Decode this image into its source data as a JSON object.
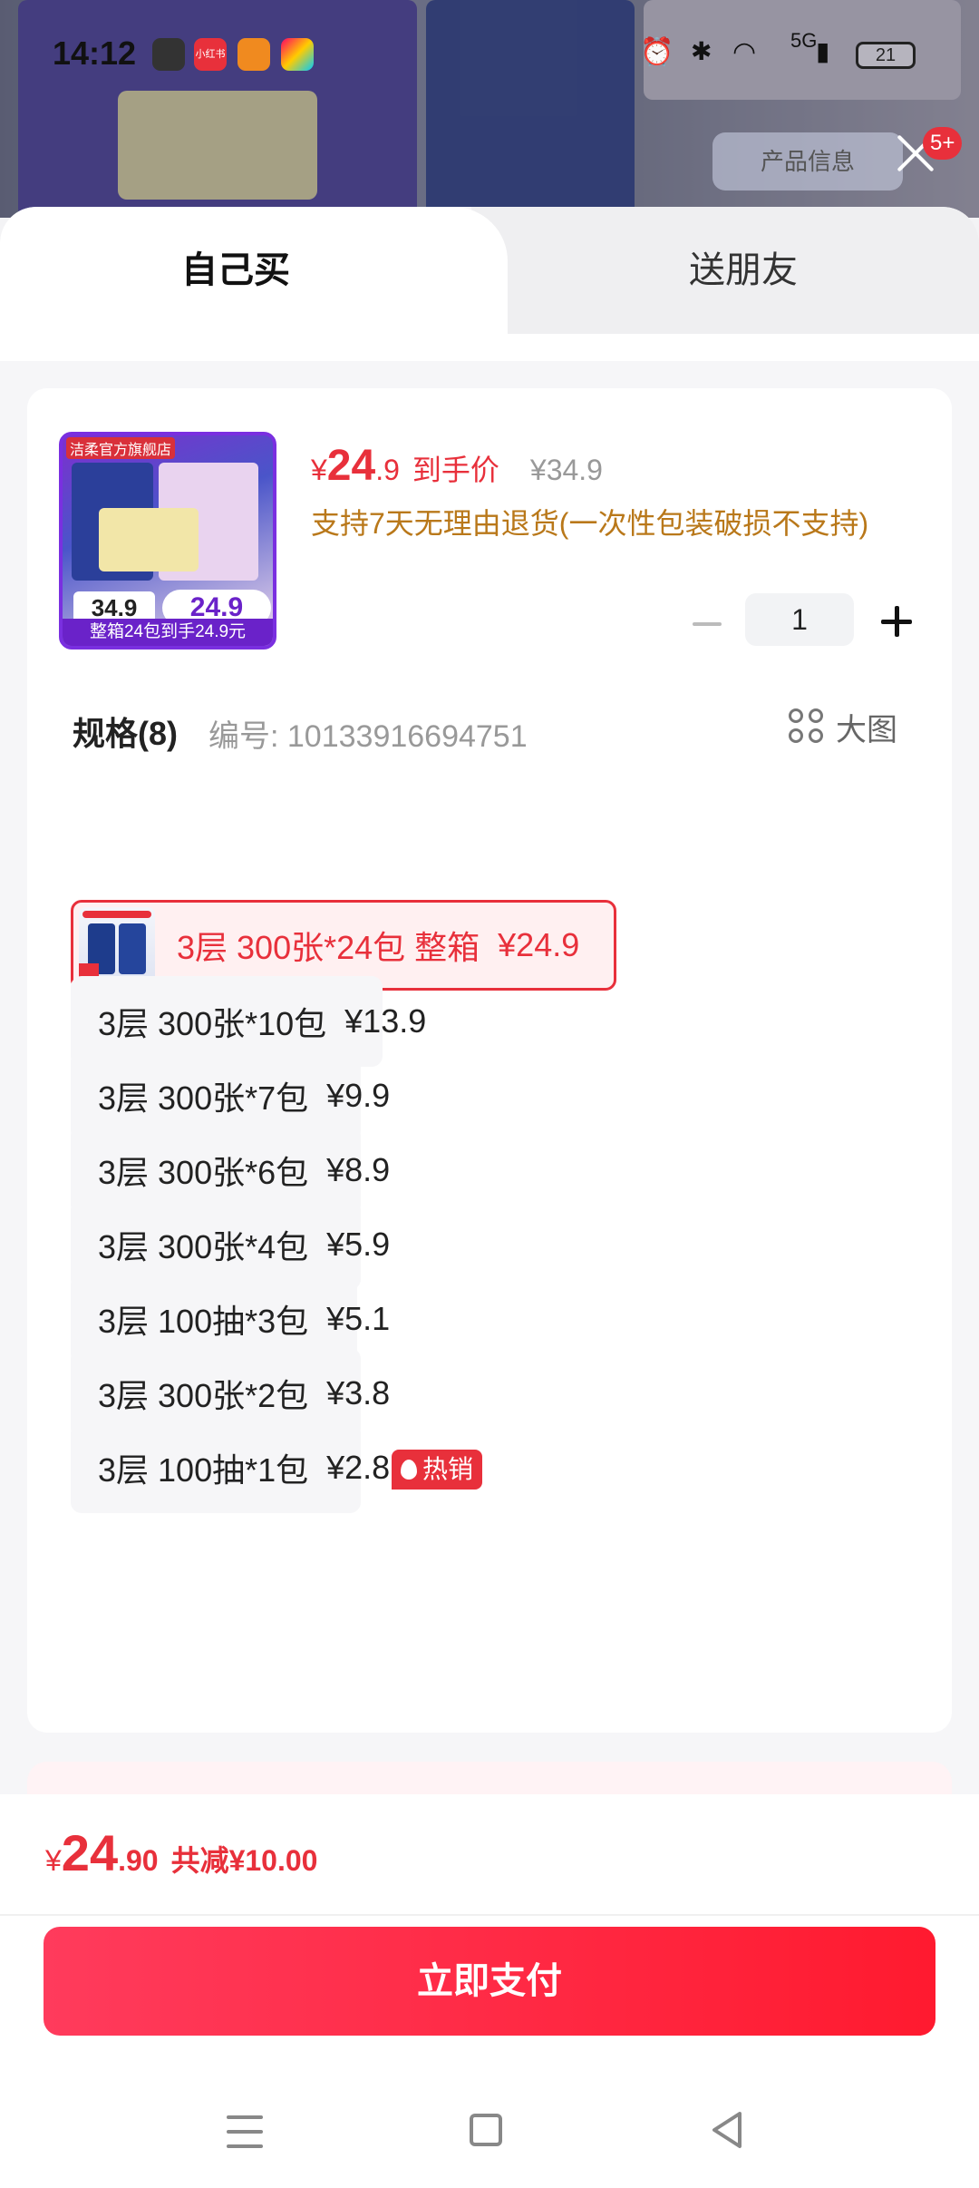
{
  "status_bar": {
    "time": "14:12",
    "network": "5G",
    "battery": "21",
    "apps": [
      "小红书"
    ]
  },
  "overlay": {
    "product_info_button": "产品信息",
    "notification_badge": "5+"
  },
  "tabs": {
    "self_buy": "自己买",
    "gift_friend": "送朋友"
  },
  "product": {
    "thumb_store": "洁柔官方旗舰店",
    "thumb_banner": "整箱24包到手24.9元",
    "thumb_price_big": "24.9",
    "thumb_price_old": "34.9",
    "price_symbol": "¥",
    "price_int": "24",
    "price_dec": ".9",
    "price_label": "到手价",
    "original_price": "¥34.9",
    "return_policy": "支持7天无理由退货(一次性包装破损不支持)"
  },
  "quantity": {
    "value": "1"
  },
  "spec": {
    "heading": "规格(8)",
    "item_no": "编号: 10133916694751",
    "big_picture": "大图",
    "options": [
      {
        "label": "3层 300张*24包 整箱",
        "price": "¥24.9",
        "selected": true
      },
      {
        "label": "3层 300张*10包",
        "price": "¥13.9",
        "selected": false
      },
      {
        "label": "3层 300张*7包",
        "price": "¥9.9",
        "selected": false
      },
      {
        "label": "3层 300张*6包",
        "price": "¥8.9",
        "selected": false
      },
      {
        "label": "3层 300张*4包",
        "price": "¥5.9",
        "selected": false
      },
      {
        "label": "3层 100抽*3包",
        "price": "¥5.1",
        "selected": false
      },
      {
        "label": "3层 300张*2包",
        "price": "¥3.8",
        "selected": false
      },
      {
        "label": "3层 100抽*1包",
        "price": "¥2.8",
        "selected": false
      }
    ],
    "hot_badge": "热销"
  },
  "footer": {
    "total_symbol": "¥",
    "total_int": "24",
    "total_dec": ".90",
    "discount": "共减¥10.00",
    "pay_button": "立即支付"
  },
  "colors": {
    "accent": "#e8303b",
    "return_text": "#b9781a",
    "pay_gradient_start": "#ff3b5c",
    "pay_gradient_end": "#ff1a2f"
  }
}
